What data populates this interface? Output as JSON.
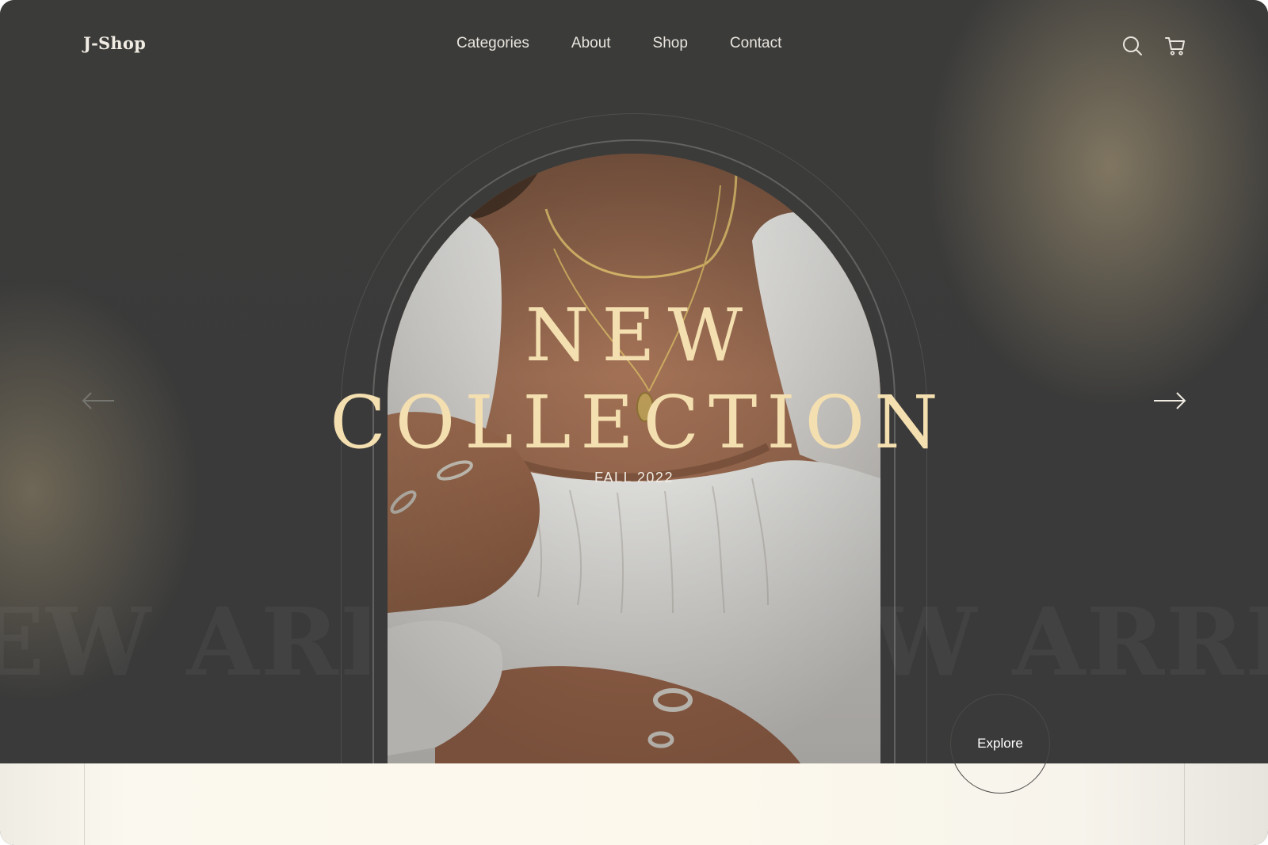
{
  "brand": {
    "logo": "J-Shop"
  },
  "nav": {
    "items": [
      {
        "label": "Categories"
      },
      {
        "label": "About"
      },
      {
        "label": "Shop"
      },
      {
        "label": "Contact"
      }
    ]
  },
  "header_icons": {
    "search": "search-icon",
    "cart": "cart-icon"
  },
  "hero": {
    "title_line1": "NEW",
    "title_line2": "COLLECTION",
    "season": "FALL 2022",
    "background_text": "NEW ARRIVAL",
    "background_text_left": "EW ARRI",
    "background_text_right": "W ARRIV",
    "explore_label": "Explore",
    "prev_icon": "arrow-left-icon",
    "next_icon": "arrow-right-icon",
    "image": "woman-with-gold-necklaces-photo"
  },
  "colors": {
    "hero_bg": "#3a3a3a",
    "title_gold": "#f4dfb0",
    "cream": "#fcf8ec",
    "text_light": "#e9e5de"
  }
}
